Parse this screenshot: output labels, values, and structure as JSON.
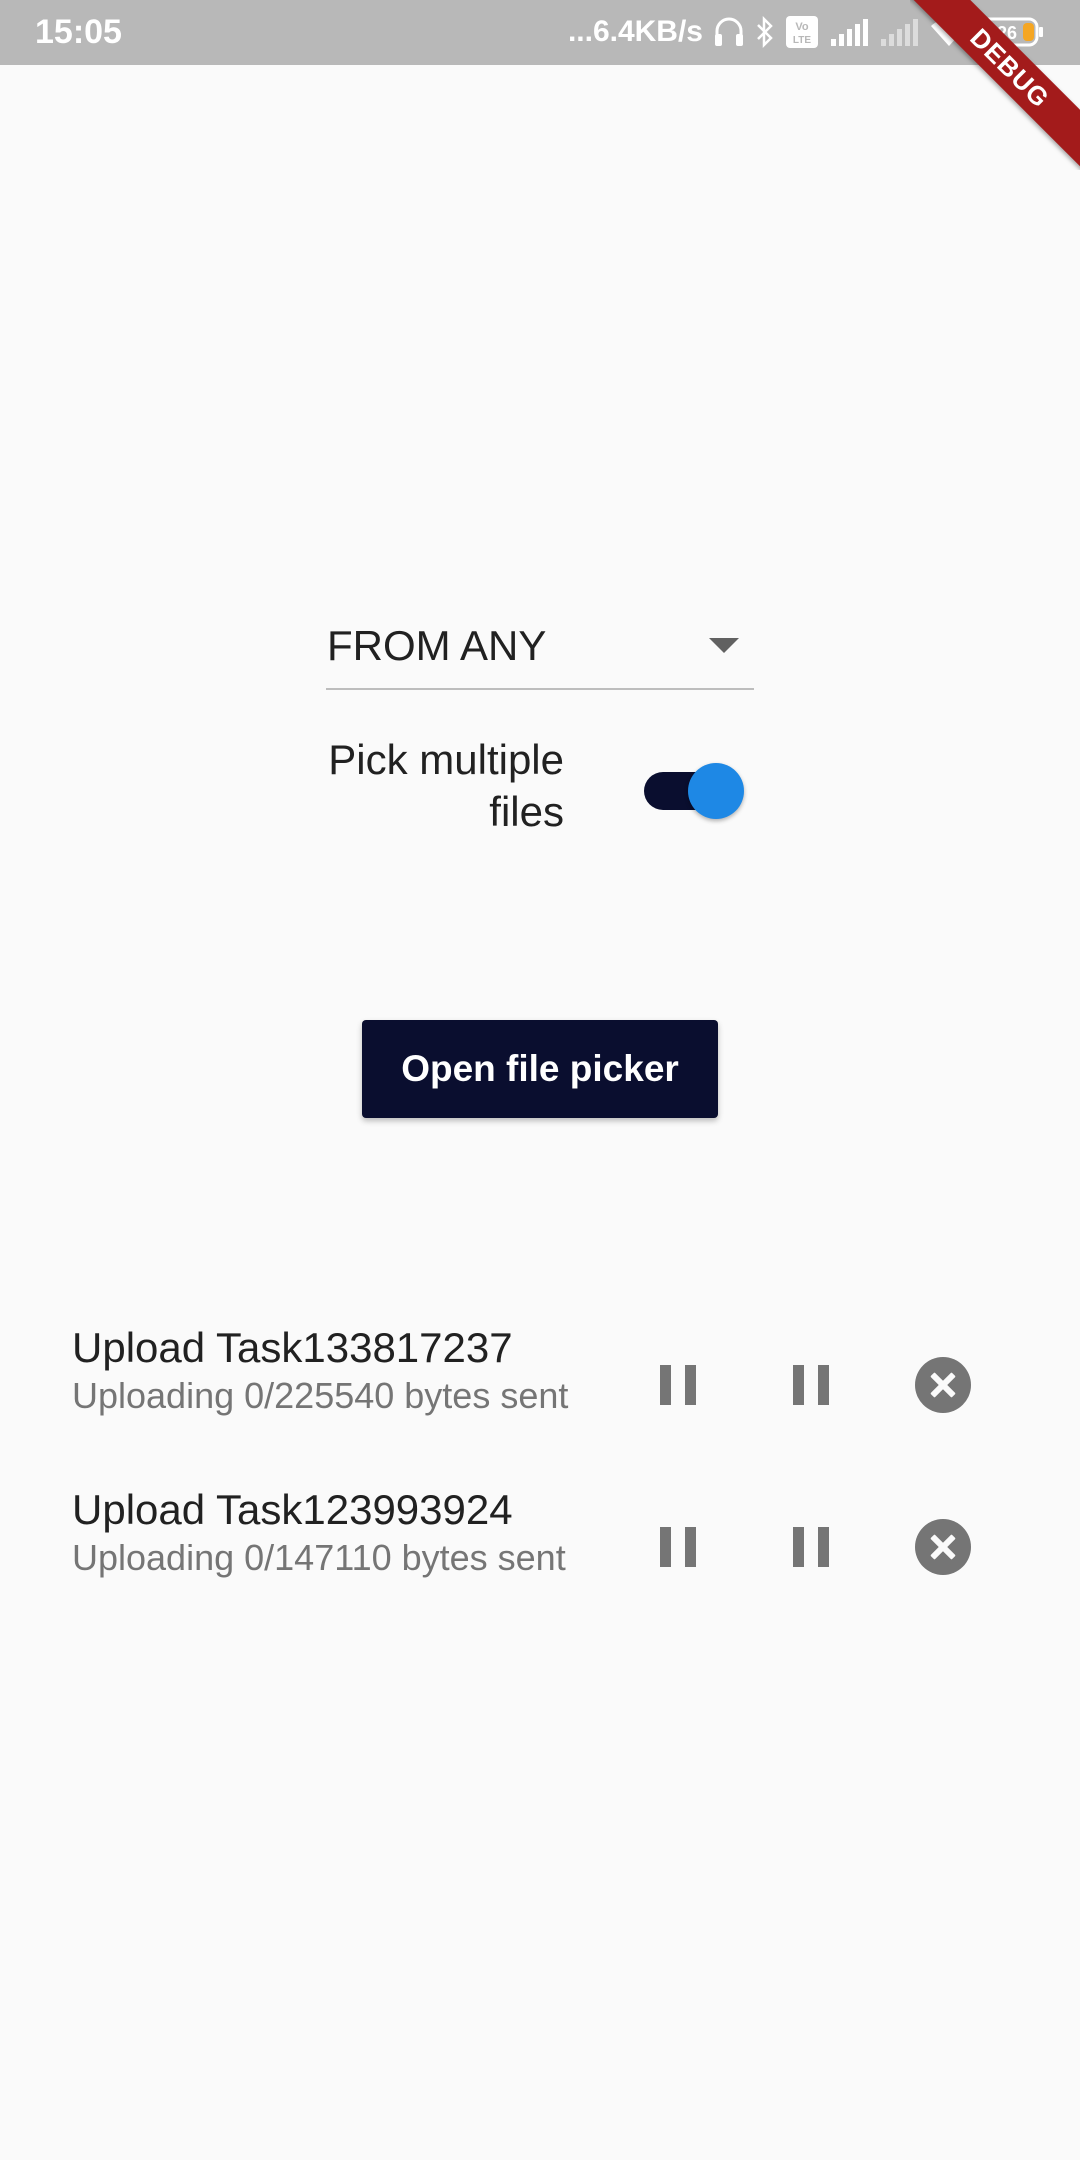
{
  "status_bar": {
    "time": "15:05",
    "network_speed": "...6.4KB/s",
    "battery_level": "26",
    "icons": [
      "headset-icon",
      "bluetooth-icon",
      "volte-icon",
      "signal-icon",
      "signal-weak-icon",
      "wifi-icon",
      "battery-icon"
    ]
  },
  "debug_banner": "DEBUG",
  "dropdown": {
    "selected": "FROM ANY"
  },
  "toggle": {
    "label": "Pick multiple files",
    "on": true
  },
  "primary_button": {
    "label": "Open file picker"
  },
  "tasks": [
    {
      "title": "Upload Task133817237",
      "status": "Uploading 0/225540 bytes sent"
    },
    {
      "title": "Upload Task123993924",
      "status": "Uploading 0/147110 bytes sent"
    }
  ],
  "colors": {
    "primary": "#0a0e2f",
    "accent": "#1e88e5",
    "status_bar": "#b8b8b8",
    "debug_ribbon": "#a31b1b",
    "icon_grey": "#757575"
  }
}
